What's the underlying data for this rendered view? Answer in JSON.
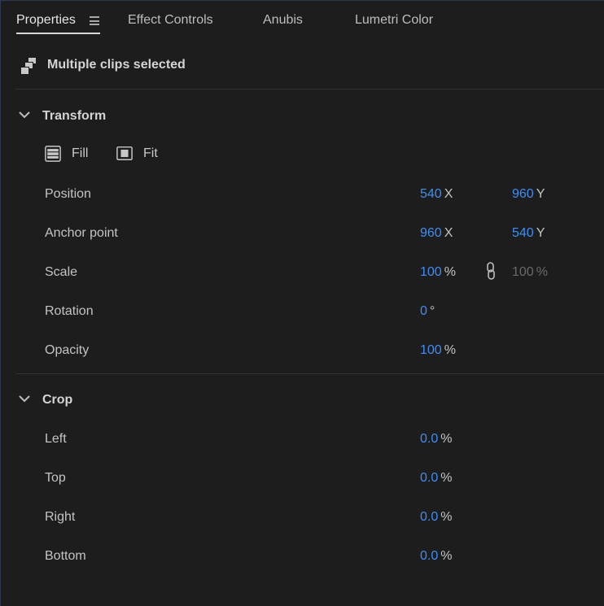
{
  "tabs": [
    {
      "label": "Properties",
      "active": true
    },
    {
      "label": "Effect Controls",
      "active": false
    },
    {
      "label": "Anubis",
      "active": false
    },
    {
      "label": "Lumetri Color",
      "active": false
    }
  ],
  "header": {
    "title": "Multiple clips selected",
    "icon": "multiple-clips-icon"
  },
  "transform": {
    "title": "Transform",
    "fill_label": "Fill",
    "fit_label": "Fit",
    "position": {
      "label": "Position",
      "x": "540",
      "x_unit": "X",
      "y": "960",
      "y_unit": "Y"
    },
    "anchor": {
      "label": "Anchor point",
      "x": "960",
      "x_unit": "X",
      "y": "540",
      "y_unit": "Y"
    },
    "scale": {
      "label": "Scale",
      "value": "100",
      "unit": "%",
      "linked_value": "100",
      "linked_unit": "%"
    },
    "rotation": {
      "label": "Rotation",
      "value": "0",
      "unit": "°"
    },
    "opacity": {
      "label": "Opacity",
      "value": "100",
      "unit": "%"
    }
  },
  "crop": {
    "title": "Crop",
    "left": {
      "label": "Left",
      "value": "0.0",
      "unit": "%"
    },
    "top": {
      "label": "Top",
      "value": "0.0",
      "unit": "%"
    },
    "right": {
      "label": "Right",
      "value": "0.0",
      "unit": "%"
    },
    "bottom": {
      "label": "Bottom",
      "value": "0.0",
      "unit": "%"
    }
  },
  "colors": {
    "accent": "#3e8ef7",
    "background": "#1d1d1d",
    "text": "#c4c4c4"
  }
}
